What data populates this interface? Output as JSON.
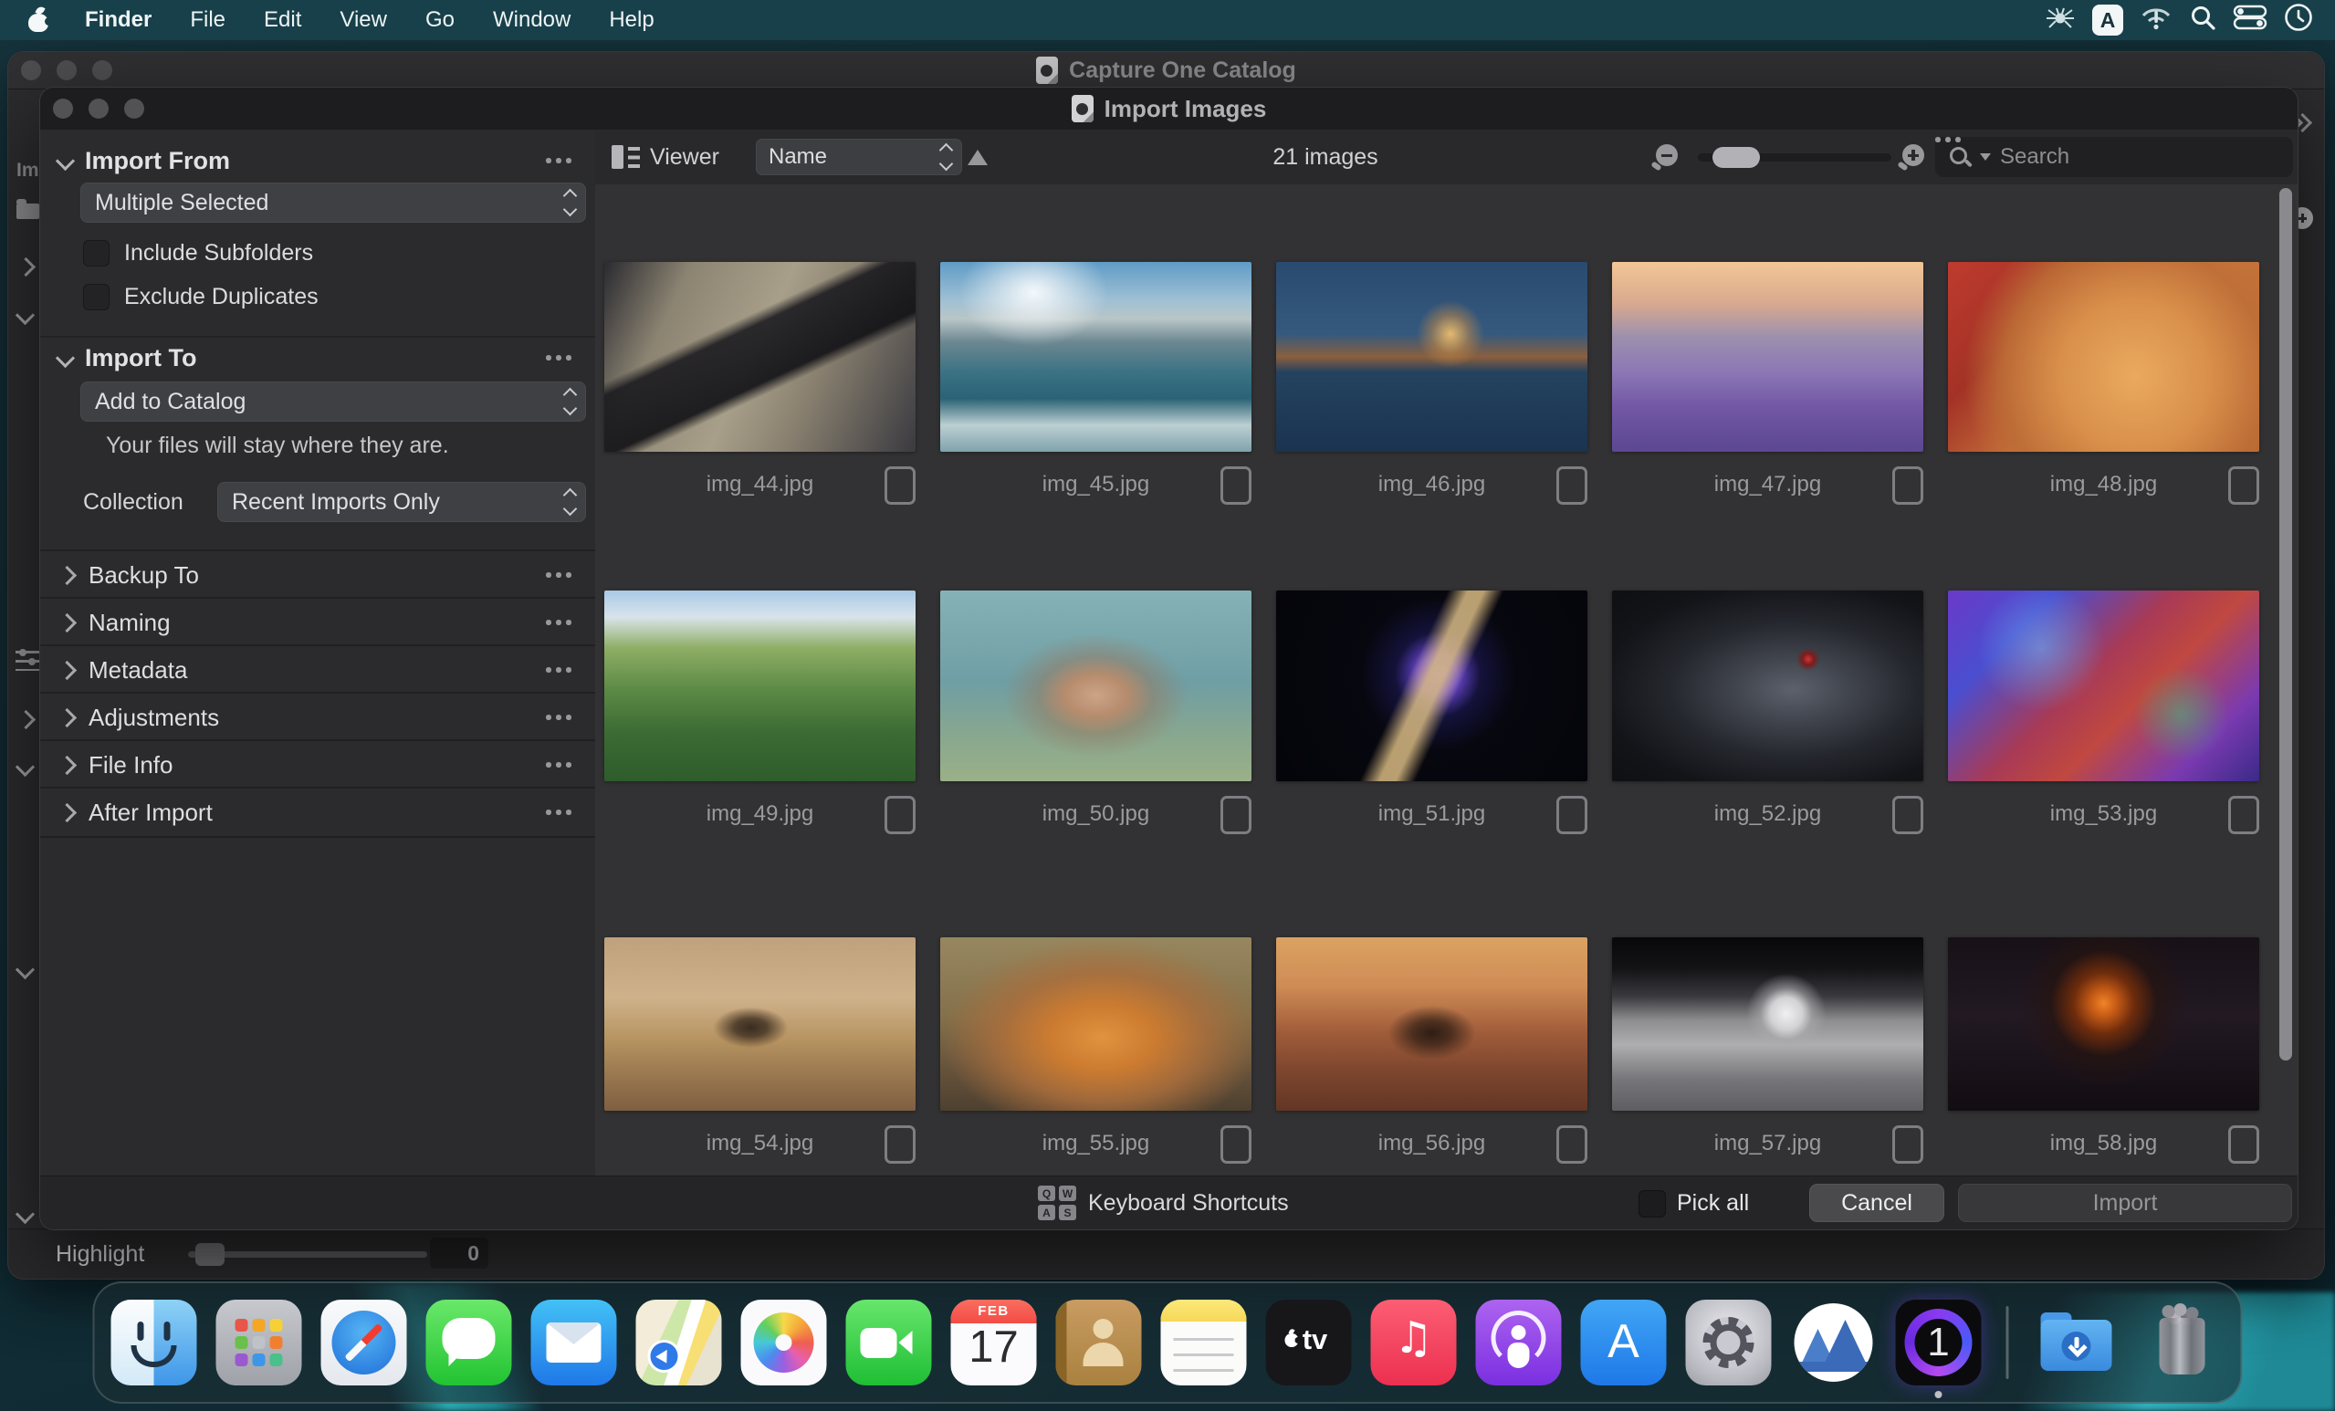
{
  "menu_bar": {
    "items": [
      "Finder",
      "File",
      "Edit",
      "View",
      "Go",
      "Window",
      "Help"
    ],
    "input_source_letter": "A",
    "status_icons": [
      "antivirus-spider-icon",
      "input-source-icon",
      "wifi-alert-icon",
      "spotlight-search-icon",
      "control-center-icon",
      "clock-icon"
    ]
  },
  "background_window": {
    "title": "Capture One Catalog",
    "left_rail_text": "Im",
    "highlight": {
      "label": "Highlight",
      "value": "0"
    }
  },
  "dialog": {
    "title": "Import Images",
    "sidebar": {
      "import_from": {
        "title": "Import From",
        "source_value": "Multiple Selected",
        "include_subfolders": "Include Subfolders",
        "exclude_duplicates": "Exclude Duplicates"
      },
      "import_to": {
        "title": "Import To",
        "destination_value": "Add to Catalog",
        "note": "Your files will stay where they are.",
        "collection_label": "Collection",
        "collection_value": "Recent Imports Only"
      },
      "sections": [
        {
          "label": "Backup To"
        },
        {
          "label": "Naming"
        },
        {
          "label": "Metadata"
        },
        {
          "label": "Adjustments"
        },
        {
          "label": "File Info"
        },
        {
          "label": "After Import"
        }
      ]
    },
    "toolbar": {
      "viewer_label": "Viewer",
      "sort_by": "Name",
      "image_count": "21 images",
      "search_placeholder": "Search"
    },
    "grid": {
      "items": [
        {
          "file": "img_44.jpg"
        },
        {
          "file": "img_45.jpg"
        },
        {
          "file": "img_46.jpg"
        },
        {
          "file": "img_47.jpg"
        },
        {
          "file": "img_48.jpg"
        },
        {
          "file": "img_49.jpg"
        },
        {
          "file": "img_50.jpg"
        },
        {
          "file": "img_51.jpg"
        },
        {
          "file": "img_52.jpg"
        },
        {
          "file": "img_53.jpg"
        },
        {
          "file": "img_54.jpg"
        },
        {
          "file": "img_55.jpg"
        },
        {
          "file": "img_56.jpg"
        },
        {
          "file": "img_57.jpg"
        },
        {
          "file": "img_58.jpg"
        }
      ]
    },
    "footer": {
      "keyboard_shortcuts": "Keyboard Shortcuts",
      "keys": [
        "Q",
        "W",
        "A",
        "S"
      ],
      "pick_all": "Pick all",
      "cancel": "Cancel",
      "import": "Import"
    }
  },
  "dock": {
    "calendar": {
      "month": "FEB",
      "day": "17"
    },
    "tv_label": "tv",
    "items": [
      "finder",
      "launchpad",
      "safari",
      "messages",
      "mail",
      "maps",
      "photos",
      "facetime",
      "calendar",
      "contacts",
      "notes",
      "apple-tv",
      "music",
      "podcasts",
      "app-store",
      "system-settings",
      "app-cleaner",
      "capture-one",
      "downloads",
      "trash"
    ]
  },
  "colors": {
    "menubar_teal": "#18404a",
    "grid_bg": "#323234",
    "sidebar_bg": "#2b2b2d",
    "accent_teal": "#2aa9b0"
  }
}
